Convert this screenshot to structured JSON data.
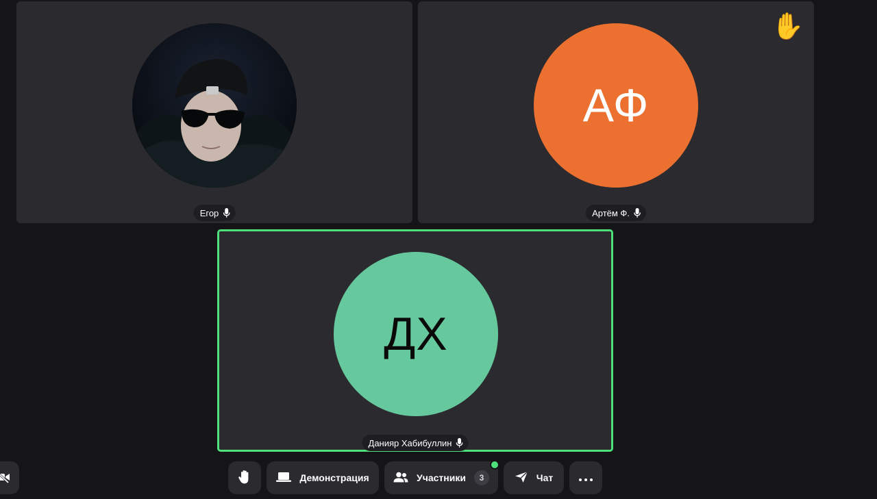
{
  "participants": [
    {
      "name": "Егор",
      "initials": "",
      "avatar_type": "photo",
      "mic": "mic-icon"
    },
    {
      "name": "Артём Ф.",
      "initials": "АФ",
      "avatar_color": "#ec7030",
      "mic": "mic-icon",
      "hand_raised": true,
      "hand_glyph": "✋"
    },
    {
      "name": "Данияр Хабибуллин",
      "initials": "ДХ",
      "avatar_color": "#66c99e",
      "mic": "mic-icon",
      "speaking": true
    }
  ],
  "toolbar": {
    "camera": {
      "icon": "camera-off-icon"
    },
    "raise_hand": {
      "icon": "raised-hand-icon"
    },
    "share_screen": {
      "label": "Демонстрация",
      "icon": "laptop-icon"
    },
    "participants": {
      "label": "Участники",
      "icon": "people-icon",
      "count": "3"
    },
    "chat": {
      "label": "Чат",
      "icon": "send-icon"
    },
    "more": {
      "icon": "more-dots-icon"
    }
  },
  "colors": {
    "background": "#151517",
    "tile": "#2b2a2f",
    "active_border": "#4ee07a"
  }
}
